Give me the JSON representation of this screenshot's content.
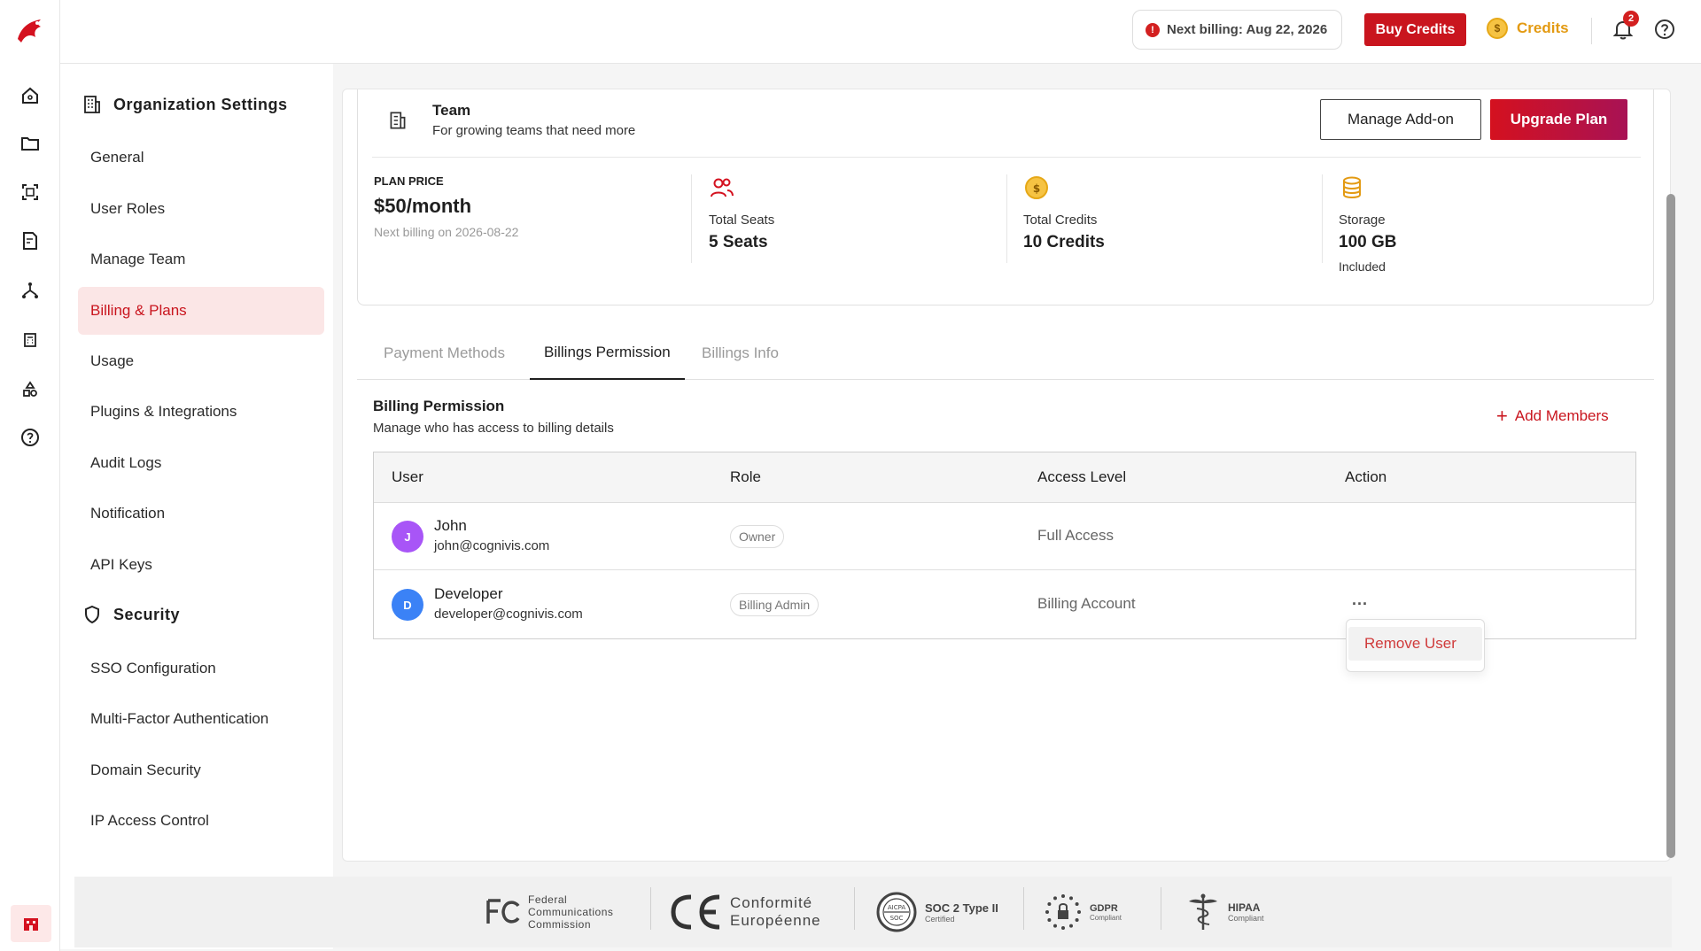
{
  "header": {
    "billing_notice": "Next billing: Aug 22, 2026",
    "buy_credits": "Buy Credits",
    "credits": "Credits",
    "notification_count": "2"
  },
  "sidebar": {
    "org_title": "Organization Settings",
    "org_items": [
      {
        "label": "General"
      },
      {
        "label": "User Roles"
      },
      {
        "label": "Manage Team"
      },
      {
        "label": "Billing & Plans",
        "active": true
      },
      {
        "label": "Usage"
      },
      {
        "label": "Plugins & Integrations"
      },
      {
        "label": "Audit Logs"
      },
      {
        "label": "Notification"
      },
      {
        "label": "API Keys"
      }
    ],
    "security_title": "Security",
    "security_items": [
      {
        "label": "SSO Configuration"
      },
      {
        "label": "Multi-Factor Authentication"
      },
      {
        "label": "Domain Security"
      },
      {
        "label": "IP Access Control"
      }
    ]
  },
  "plan": {
    "name": "Team",
    "subtitle": "For growing teams that need more",
    "manage_addon": "Manage Add-on",
    "upgrade": "Upgrade Plan",
    "price_label": "PLAN PRICE",
    "price": "$50/month",
    "next_billing": "Next billing on 2026-08-22",
    "seats_label": "Total Seats",
    "seats_value": "5 Seats",
    "credits_label": "Total Credits",
    "credits_value": "10 Credits",
    "storage_label": "Storage",
    "storage_value": "100 GB",
    "storage_note": "Included"
  },
  "tabs": [
    {
      "label": "Payment Methods"
    },
    {
      "label": "Billings Permission",
      "active": true
    },
    {
      "label": "Billings Info"
    }
  ],
  "permission": {
    "title": "Billing Permission",
    "subtitle": "Manage who has access to billing details",
    "add_members": "Add Members",
    "columns": [
      "User",
      "Role",
      "Access Level",
      "Action"
    ],
    "rows": [
      {
        "initial": "J",
        "name": "John",
        "email": "john@cognivis.com",
        "role": "Owner",
        "access": "Full Access",
        "avatar_color": "#a855f7",
        "action": ""
      },
      {
        "initial": "D",
        "name": "Developer",
        "email": "developer@cognivis.com",
        "role": "Billing Admin",
        "access": "Billing Account",
        "avatar_color": "#3b82f6",
        "action": "..."
      }
    ],
    "menu_option": "Remove User"
  },
  "footer": {
    "fcc_line1": "Federal",
    "fcc_line2": "Communications",
    "fcc_line3": "Commission",
    "ce_line1": "Conformité",
    "ce_line2": "Européenne",
    "soc_title": "SOC 2 Type II",
    "soc_sub": "Certified",
    "soc_seal_top": "AICPA",
    "soc_seal_bottom": "SOC",
    "gdpr_title": "GDPR",
    "gdpr_sub": "Compliant",
    "hipaa_title": "HIPAA",
    "hipaa_sub": "Compliant"
  },
  "colors": {
    "accent": "#c9151e",
    "credits": "#e39a12"
  }
}
